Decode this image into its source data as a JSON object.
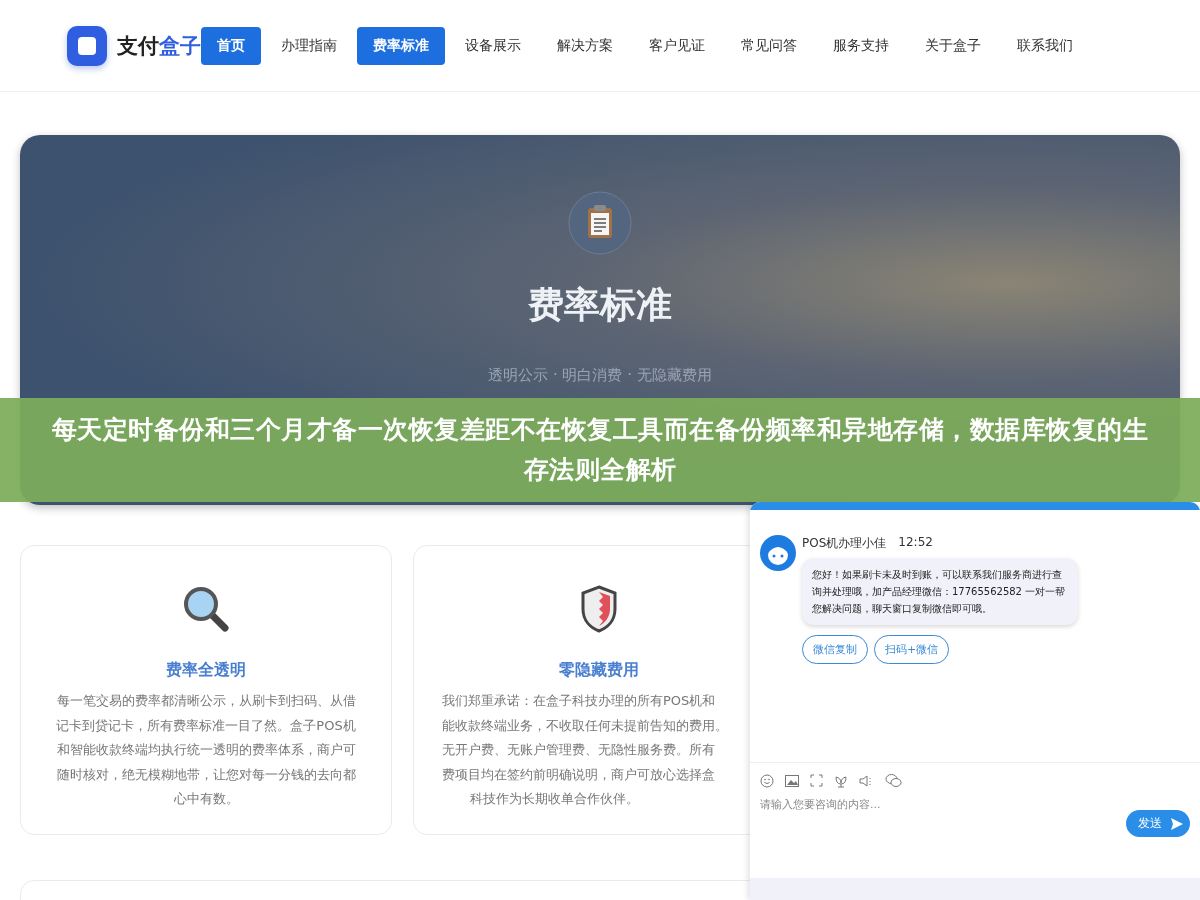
{
  "logo": {
    "text": "支付",
    "accent": "盒子"
  },
  "nav": [
    {
      "label": "首页",
      "selected": true
    },
    {
      "label": "办理指南",
      "selected": false
    },
    {
      "label": "费率标准",
      "selected": true
    },
    {
      "label": "设备展示",
      "selected": false
    },
    {
      "label": "解决方案",
      "selected": false
    },
    {
      "label": "客户见证",
      "selected": false
    },
    {
      "label": "常见问答",
      "selected": false
    },
    {
      "label": "服务支持",
      "selected": false
    },
    {
      "label": "关于盒子",
      "selected": false
    },
    {
      "label": "联系我们",
      "selected": false
    }
  ],
  "hero": {
    "title": "费率标准",
    "subtitle": "透明公示 · 明白消费 · 无隐藏费用"
  },
  "headline": "每天定时备份和三个月才备一次恢复差距不在恢复工具而在备份频率和异地存储，数据库恢复的生存法则全解析",
  "cards": [
    {
      "kind": "magnifier",
      "title": "费率全透明",
      "lines": [
        "每一笔交易的费率都清晰公示，从刷卡到扫码、从借记卡到贷记卡，所有费率标准一目了然。盒子POS机和智能收款终端均执行统一透明的费率体系，商户可随时核对，绝无模糊地带，让您对每一分钱的去向都心中有数。"
      ]
    },
    {
      "kind": "shield",
      "title": "零隐藏费用",
      "lines": [
        "我们郑重承诺：在盒子科技办理的所有POS机和",
        "能收款终端业务，不收取任何未提前告知的费用。",
        "无开户费、无账户管理费、无隐性服务费。所有",
        "费项目均在签约前明确说明，商户可放心选择盒",
        "科技作为长期收单合作伙伴。"
      ]
    }
  ],
  "chat": {
    "sender": "POS机办理小佳",
    "time": "12:52",
    "message": "您好！如果刷卡未及时到账，可以联系我们服务商进行查询并处理哦，加产品经理微信：17765562582 一对一帮您解决问题，聊天窗口复制微信即可哦。",
    "actions": [
      "微信复制",
      "扫码+微信"
    ],
    "placeholder": "请输入您要咨询的内容...",
    "send": "发送"
  }
}
